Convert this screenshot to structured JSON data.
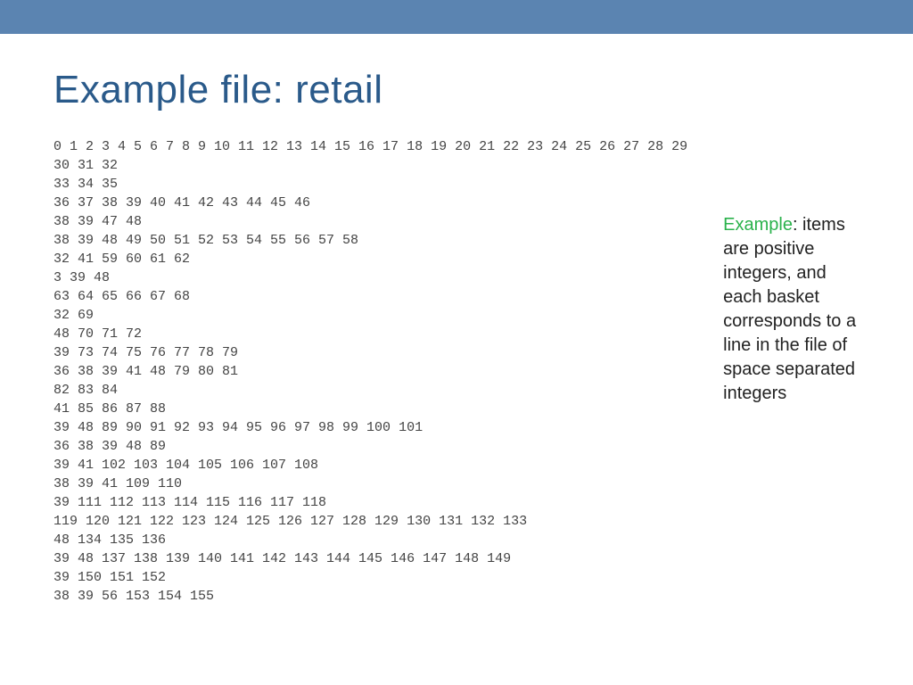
{
  "title": "Example file: retail",
  "file_lines": [
    "0 1 2 3 4 5 6 7 8 9 10 11 12 13 14 15 16 17 18 19 20 21 22 23 24 25 26 27 28 29",
    "30 31 32",
    "33 34 35",
    "36 37 38 39 40 41 42 43 44 45 46",
    "38 39 47 48",
    "38 39 48 49 50 51 52 53 54 55 56 57 58",
    "32 41 59 60 61 62",
    "3 39 48",
    "63 64 65 66 67 68",
    "32 69",
    "48 70 71 72",
    "39 73 74 75 76 77 78 79",
    "36 38 39 41 48 79 80 81",
    "82 83 84",
    "41 85 86 87 88",
    "39 48 89 90 91 92 93 94 95 96 97 98 99 100 101",
    "36 38 39 48 89",
    "39 41 102 103 104 105 106 107 108",
    "38 39 41 109 110",
    "39 111 112 113 114 115 116 117 118",
    "119 120 121 122 123 124 125 126 127 128 129 130 131 132 133",
    "48 134 135 136",
    "39 48 137 138 139 140 141 142 143 144 145 146 147 148 149",
    "39 150 151 152",
    "38 39 56 153 154 155"
  ],
  "note": {
    "highlight": "Example",
    "rest": ": items are positive integers,\nand each basket corresponds to a line in the file of space separated integers"
  }
}
